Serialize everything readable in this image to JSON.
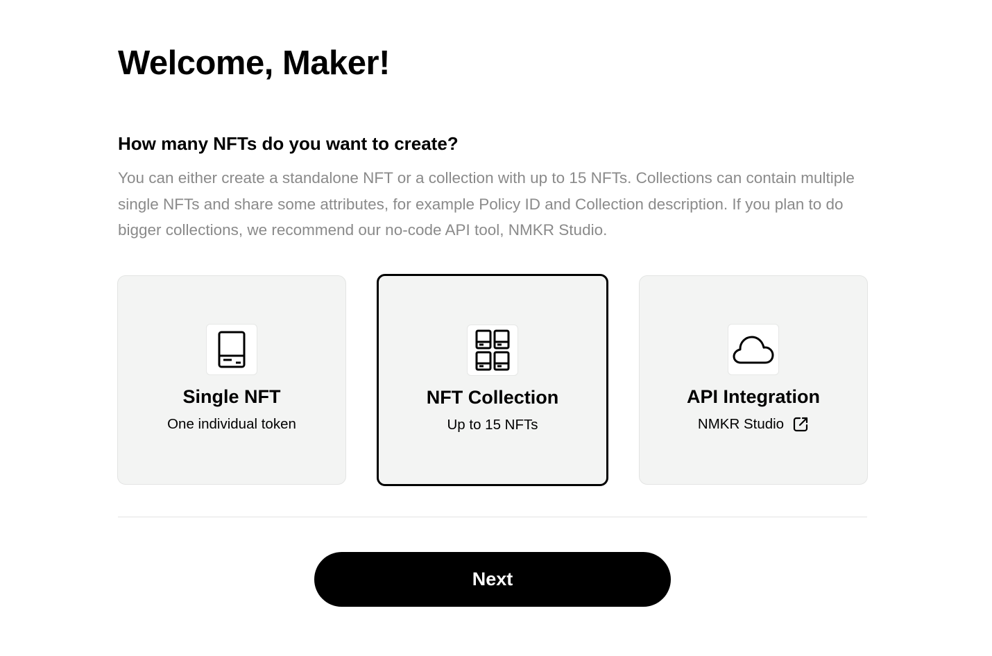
{
  "header": {
    "title": "Welcome, Maker!"
  },
  "intro": {
    "question": "How many NFTs do you want to create?",
    "description": "You can either create a standalone NFT or a collection with up to 15 NFTs. Collections can contain multiple single NFTs and share some attributes, for example Policy ID and Collection description. If you plan to do bigger collections, we recommend our no-code API tool, NMKR Studio."
  },
  "options": [
    {
      "title": "Single NFT",
      "subtitle": "One individual token",
      "icon": "single-card-icon",
      "selected": false
    },
    {
      "title": "NFT Collection",
      "subtitle": "Up to 15 NFTs",
      "icon": "collection-grid-icon",
      "selected": true
    },
    {
      "title": "API Integration",
      "subtitle": "NMKR Studio",
      "icon": "cloud-icon",
      "trailing_icon": "external-link-icon",
      "selected": false
    }
  ],
  "footer": {
    "next_label": "Next"
  },
  "colors": {
    "card_background": "#f3f4f3",
    "selected_border": "#000000",
    "description_text": "#8a8a8a",
    "button_background": "#000000",
    "button_text": "#ffffff"
  }
}
